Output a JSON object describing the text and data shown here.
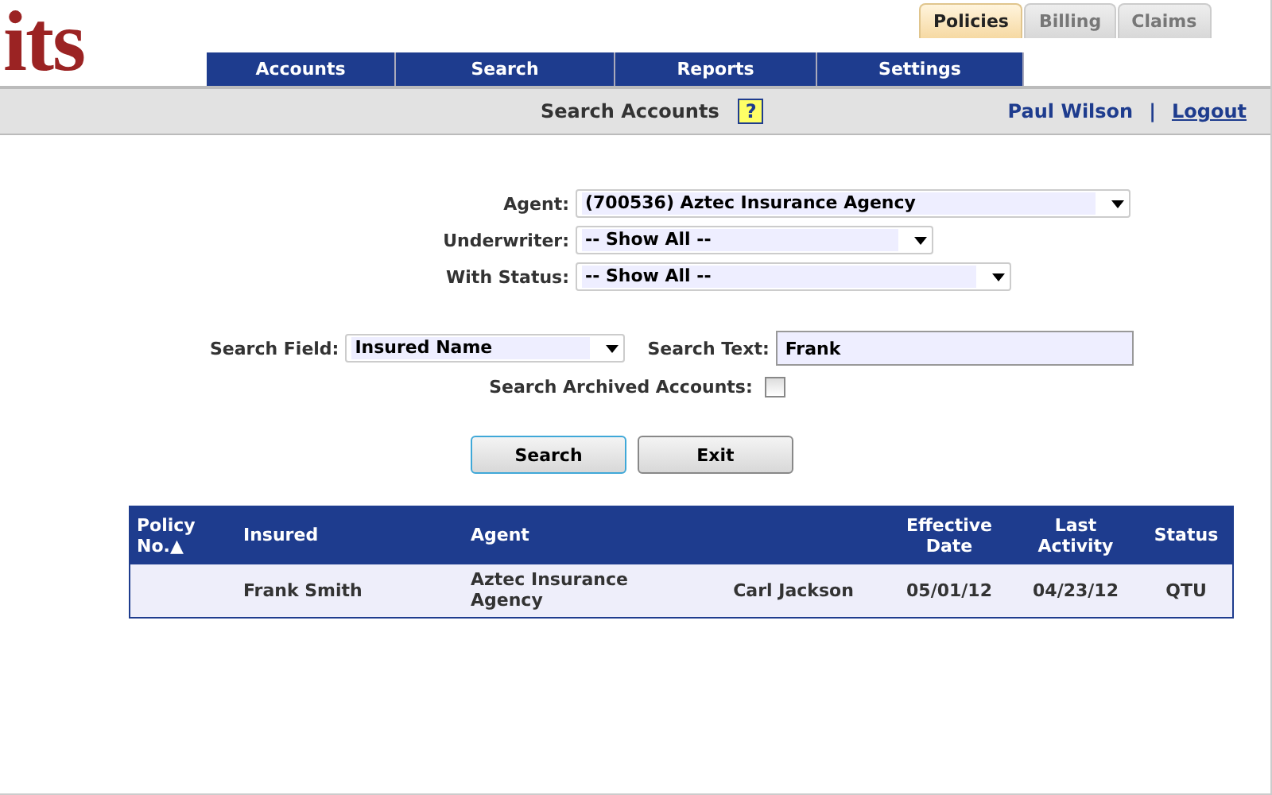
{
  "logo": "its",
  "top_tabs": [
    {
      "label": "Policies",
      "selected": true
    },
    {
      "label": "Billing",
      "selected": false
    },
    {
      "label": "Claims",
      "selected": false
    }
  ],
  "nav": [
    "Accounts",
    "Search",
    "Reports",
    "Settings"
  ],
  "header": {
    "title": "Search Accounts",
    "help": "?",
    "user": "Paul Wilson",
    "separator": "|",
    "logout": "Logout"
  },
  "filters": [
    {
      "label": "Agent:",
      "value": "(700536) Aztec Insurance Agency"
    },
    {
      "label": "Underwriter:",
      "value": "-- Show All --"
    },
    {
      "label": "With Status:",
      "value": "-- Show All --"
    }
  ],
  "search_field": {
    "label": "Search Field:",
    "value": "Insured Name"
  },
  "search_text": {
    "label": "Search Text:",
    "value": "Frank"
  },
  "archived": {
    "label": "Search Archived Accounts:",
    "checked": false
  },
  "buttons": [
    {
      "label": "Search",
      "focused": true
    },
    {
      "label": "Exit",
      "focused": false
    }
  ],
  "table": {
    "columns": [
      {
        "label": "Policy No.",
        "sort": "▲"
      },
      {
        "label": "Insured"
      },
      {
        "label": "Agent"
      },
      {},
      {
        "label": "Effective Date"
      },
      {
        "label": "Last Activity"
      },
      {
        "label": "Status"
      }
    ],
    "rows": [
      {
        "cells": [
          null,
          "Frank Smith",
          "Aztec Insurance Agency",
          "Carl Jackson",
          "05/01/12",
          "04/23/12",
          "QTU"
        ]
      }
    ]
  }
}
